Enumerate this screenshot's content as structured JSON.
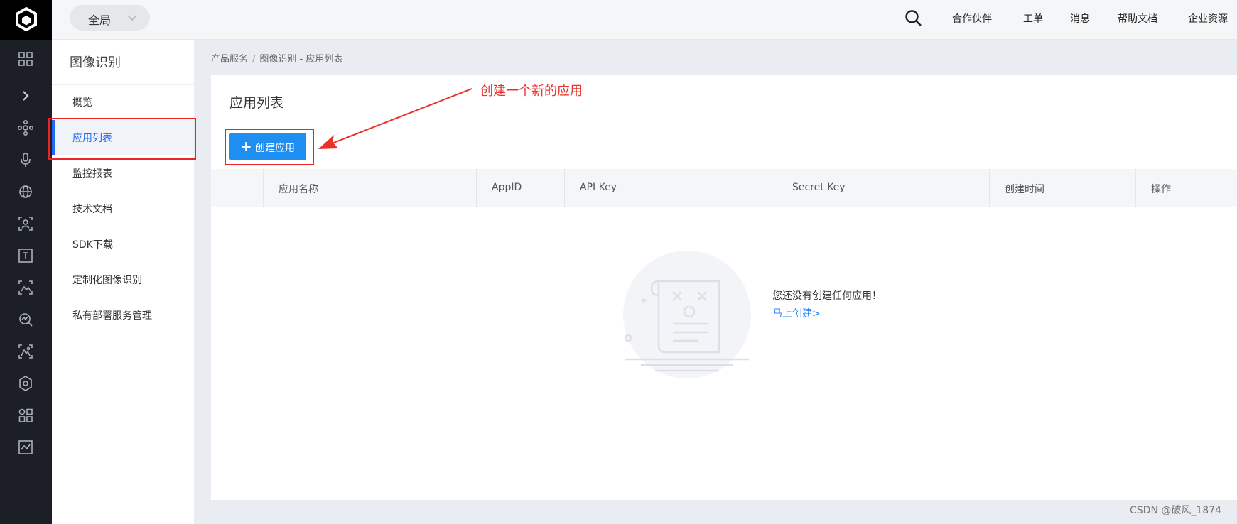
{
  "topbar": {
    "scope_label": "全局",
    "nav": [
      "合作伙伴",
      "工单",
      "消息",
      "帮助文档",
      "企业资源"
    ]
  },
  "rail_icons": [
    "grid-icon",
    "expand-chevron-icon",
    "network-icon",
    "microphone-icon",
    "globe-icon",
    "face-scan-icon",
    "text-recognition-icon",
    "image-scan-icon",
    "search-analysis-icon",
    "image-recognition-icon",
    "hexagon-icon",
    "apps-icon",
    "monitor-chart-icon"
  ],
  "sidebar": {
    "title": "图像识别",
    "items": [
      {
        "label": "概览",
        "active": false
      },
      {
        "label": "应用列表",
        "active": true
      },
      {
        "label": "监控报表",
        "active": false
      },
      {
        "label": "技术文档",
        "active": false
      },
      {
        "label": "SDK下载",
        "active": false
      },
      {
        "label": "定制化图像识别",
        "active": false
      },
      {
        "label": "私有部署服务管理",
        "active": false
      }
    ]
  },
  "breadcrumb": {
    "root": "产品服务",
    "separator": "/",
    "current": "图像识别 - 应用列表"
  },
  "main": {
    "title": "应用列表",
    "create_button": "创建应用",
    "columns": [
      "应用名称",
      "AppID",
      "API Key",
      "Secret Key",
      "创建时间",
      "操作"
    ],
    "empty_message": "您还没有创建任何应用！",
    "create_link": "马上创建>"
  },
  "annotation": {
    "text": "创建一个新的应用",
    "color": "#e8332d"
  },
  "colors": {
    "accent": "#2468f2",
    "button": "#1e8ff0",
    "highlight": "#e22"
  },
  "watermark": "CSDN @破风_1874"
}
